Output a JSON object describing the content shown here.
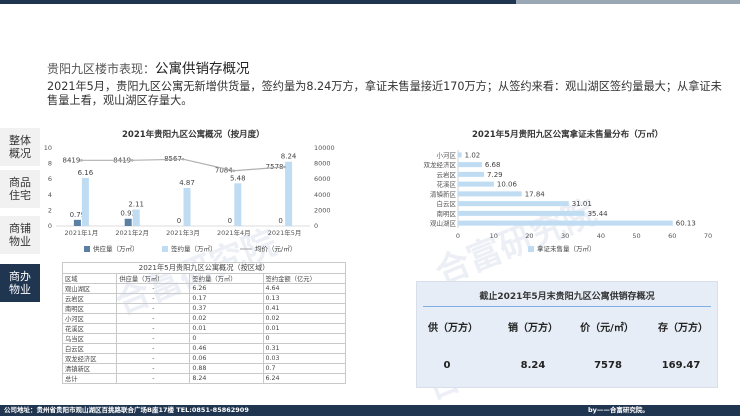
{
  "title": {
    "prefix": "贵阳九区楼市表现：",
    "main": "公寓供销存概况"
  },
  "summary": "2021年5月，贵阳九区公寓无新增供货量，签约量为8.24万方，拿证未售量接近170万方；从签约来看：观山湖区签约量最大；从拿证未售量上看，观山湖区存量大。",
  "sidebar": {
    "tabs": [
      {
        "label_line1": "整体",
        "label_line2": "概况",
        "active": false
      },
      {
        "label_line1": "商品",
        "label_line2": "住宅",
        "active": false
      },
      {
        "label_line1": "商铺",
        "label_line2": "物业",
        "active": false
      },
      {
        "label_line1": "商办",
        "label_line2": "物业",
        "active": true
      }
    ]
  },
  "combo_chart": {
    "title": "2021年贵阳九区公寓概况（按月度）",
    "left_ticks": [
      "0",
      "2",
      "4",
      "6",
      "8",
      "10"
    ],
    "right_ticks": [
      "0",
      "2000",
      "4000",
      "6000",
      "8000",
      "10000"
    ],
    "legend": {
      "supply": "供应量（万㎡）",
      "signed": "签约量（万㎡）",
      "price": "均价（元/㎡）"
    }
  },
  "bar_chart": {
    "title": "2021年5月贵阳九区公寓拿证未售量分布（万㎡）",
    "x_ticks": [
      "0",
      "10",
      "20",
      "30",
      "40",
      "50",
      "60",
      "70"
    ],
    "legend": "拿证未售量（万㎡）"
  },
  "chart_data": [
    {
      "type": "bar",
      "title": "2021年贵阳九区公寓概况（按月度）",
      "categories": [
        "2021年1月",
        "2021年2月",
        "2021年3月",
        "2021年4月",
        "2021年5月"
      ],
      "series": [
        {
          "name": "供应量（万㎡）",
          "values": [
            0.79,
            0.93,
            0,
            0,
            0
          ],
          "labels": [
            "0.79",
            "0.93",
            "0",
            "0",
            "0"
          ]
        },
        {
          "name": "签约量（万㎡）",
          "values": [
            6.16,
            2.11,
            4.87,
            5.48,
            8.24
          ],
          "labels": [
            "6.16",
            "2.11",
            "4.87",
            "5.48",
            "8.24"
          ]
        },
        {
          "name": "均价（元/㎡）",
          "type": "line",
          "axis": "right",
          "values": [
            8419,
            8419,
            8567,
            7084,
            7578
          ],
          "labels": [
            "8419",
            "8419",
            "8567",
            "7084",
            "7578"
          ]
        }
      ],
      "ylim": [
        0,
        10
      ],
      "y2lim": [
        0,
        10000
      ],
      "grid": false,
      "legend": "bottom"
    },
    {
      "type": "bar",
      "orientation": "horizontal",
      "title": "2021年5月贵阳九区公寓拿证未售量分布（万㎡）",
      "categories": [
        "小河区",
        "双龙经济区",
        "云岩区",
        "花溪区",
        "清镇新区",
        "白云区",
        "南明区",
        "观山湖区"
      ],
      "values": [
        1.02,
        6.68,
        7.29,
        10.06,
        17.84,
        31.01,
        35.44,
        60.13
      ],
      "series_name": "拿证未售量（万㎡）",
      "xlim": [
        0,
        70
      ],
      "grid": false,
      "legend": "bottom"
    }
  ],
  "region_table": {
    "caption": "2021年5月贵阳九区公寓概况（按区域）",
    "headers": [
      "区域",
      "供应量（万㎡）",
      "签约量（万㎡）",
      "签约金额（亿元）"
    ],
    "rows": [
      [
        "观山湖区",
        "-",
        "6.26",
        "4.64"
      ],
      [
        "云岩区",
        "-",
        "0.17",
        "0.13"
      ],
      [
        "南明区",
        "-",
        "0.37",
        "0.41"
      ],
      [
        "小河区",
        "-",
        "0.02",
        "0.02"
      ],
      [
        "花溪区",
        "-",
        "0.01",
        "0.01"
      ],
      [
        "乌当区",
        "-",
        "0",
        "0"
      ],
      [
        "白云区",
        "-",
        "0.46",
        "0.31"
      ],
      [
        "双龙经济区",
        "-",
        "0.06",
        "0.03"
      ],
      [
        "清镇新区",
        "-",
        "0.88",
        "0.7"
      ],
      [
        "总计",
        "-",
        "8.24",
        "6.24"
      ]
    ]
  },
  "kpi_box": {
    "title": "截止2021年5月末贵阳九区公寓供销存概况",
    "items": [
      {
        "label": "供（万方）",
        "value": "0"
      },
      {
        "label": "销（万方）",
        "value": "8.24"
      },
      {
        "label": "价（元/㎡）",
        "value": "7578"
      },
      {
        "label": "存（万方）",
        "value": "169.47"
      }
    ]
  },
  "watermark_text": "合富研究院",
  "footer": {
    "address": "公司地址：贵州省贵阳市观山湖区百挑路联合广场B座17楼      TEL:0851-85862909",
    "brand": "by——合富研究院。"
  },
  "colors": {
    "navy": "#1f3550",
    "bar_dark": "#5b7fa3",
    "bar_light": "#bfdcf3",
    "line": "#b0b0b0",
    "box_bg": "#e6edf6"
  }
}
